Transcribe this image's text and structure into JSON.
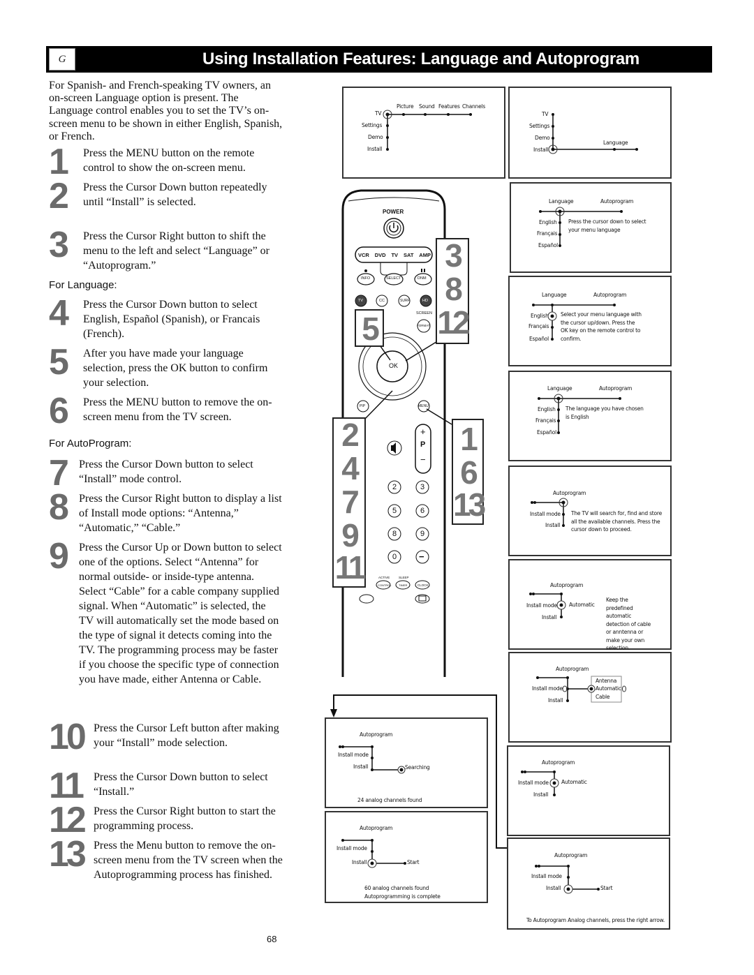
{
  "header": {
    "section_letter": "G",
    "title": "Using Installation Features: Language and Autoprogram"
  },
  "intro": "For Spanish- and French-speaking TV owners, an on-screen Language option is present. The Language control enables you to set the TV’s on-screen menu to be shown in either English, Spanish, or French.",
  "steps": [
    {
      "num": "1",
      "text": "Press the MENU button on the remote control to show the on-screen menu."
    },
    {
      "num": "2",
      "text": "Press the Cursor Down button repeatedly until “Install” is selected."
    },
    {
      "num": "3",
      "text": "Press the Cursor Right button to shift the menu to the left and select “Language” or “Autoprogram.”"
    },
    {
      "num": "4",
      "text": "Press the Cursor Down button to select English, Español (Spanish), or Francais (French)."
    },
    {
      "num": "5",
      "text": "After you have made your language selection, press the OK button to confirm your selection."
    },
    {
      "num": "6",
      "text": "Press the MENU button to remove the on-screen menu from the TV screen."
    },
    {
      "num": "7",
      "text": "Press the Cursor Down button to select “Install” mode control."
    },
    {
      "num": "8",
      "text": "Press the Cursor Right button to display a list of Install mode options: “Antenna,” “Automatic,” “Cable.”"
    },
    {
      "num": "9",
      "text": "Press the Cursor Up or Down button to select one of the options. Select “Antenna” for normal outside- or inside-type antenna. Select “Cable” for a cable company supplied signal. When “Automatic” is selected, the TV will automatically set the mode based on the type of signal it detects coming into the TV. The programming process may be faster if you choose the specific type of connection you have made, either Antenna or Cable."
    },
    {
      "num": "10",
      "text": "Press the Cursor Left button after making your “Install” mode selection."
    },
    {
      "num": "11",
      "text": "Press the Cursor Down button to select “Install.”"
    },
    {
      "num": "12",
      "text": "Press the Cursor Right button to start the programming process."
    },
    {
      "num": "13",
      "text": "Press the Menu button to remove the on-screen menu from the TV screen when the Autoprogramming process has finished."
    }
  ],
  "sections": {
    "language": "For Language:",
    "autoprogram": "For AutoProgram:"
  },
  "page_number": "68",
  "screens": {
    "s1": {
      "top": [
        "Picture",
        "Sound",
        "Features",
        "Channels"
      ],
      "left": [
        "TV",
        "Settings",
        "Demo",
        "Install"
      ]
    },
    "s2": {
      "left": [
        "TV",
        "Settings",
        "Demo",
        "Install"
      ],
      "right": "Language"
    },
    "s3": {
      "top": [
        "Language",
        "Autoprogram"
      ],
      "left": [
        "English",
        "Français",
        "Español"
      ],
      "note": "Press the cursor down to select your menu language"
    },
    "s4": {
      "top": [
        "Language",
        "Autoprogram"
      ],
      "left": [
        "English",
        "Français",
        "Español"
      ],
      "note": "Select your menu language with the cursor up/down. Press the OK key on the remote control to confirm."
    },
    "s5": {
      "top": [
        "Language",
        "Autoprogram"
      ],
      "left": [
        "English",
        "Français",
        "Español"
      ],
      "note": "The language you have chosen is English"
    },
    "s6": {
      "title": "Autoprogram",
      "left": [
        "Install mode",
        "Install"
      ],
      "note": "The TV will search for, find and store all the available channels. Press the cursor down to proceed."
    },
    "s7": {
      "title": "Autoprogram",
      "left": [
        "Install mode",
        "Install"
      ],
      "value": "Automatic",
      "note": "Keep the predefined automatic detection of cable or anntenna or make your own selection."
    },
    "s8": {
      "title": "Autoprogram",
      "left": [
        "Install mode",
        "Install"
      ],
      "options": [
        "Antenna",
        "Automatic",
        "Cable"
      ]
    },
    "s9": {
      "title": "Autoprogram",
      "left": [
        "Install mode",
        "Install"
      ],
      "value": "Automatic"
    },
    "s10": {
      "title": "Autoprogram",
      "left": [
        "Install mode",
        "Install"
      ],
      "value": "Start",
      "footer": "To Autoprogram Analog channels, press the right arrow."
    },
    "s11": {
      "title": "Autoprogram",
      "left": [
        "Install mode",
        "Install"
      ],
      "value": "Searching",
      "footer": "24 analog channels found"
    },
    "s12": {
      "title": "Autoprogram",
      "left": [
        "Install mode",
        "Install"
      ],
      "value": "Start",
      "footer": "60 analog channels found",
      "footer2": "Autoprogramming is complete"
    }
  },
  "remote": {
    "power": "POWER",
    "sources": [
      "VCR",
      "DVD",
      "TV",
      "SAT",
      "AMP"
    ],
    "row1": [
      "INFO",
      "SELECT",
      "DNM"
    ],
    "row2": [
      "TV",
      "CC",
      "SURF",
      "HD"
    ],
    "screen_label": "SCREEN",
    "format": "FORMAT",
    "ok": "OK",
    "pip": "PIP",
    "menu": "MENU",
    "prog": [
      "+",
      "P",
      "−"
    ],
    "digits": [
      "2",
      "3",
      "5",
      "6",
      "8",
      "9",
      "0",
      "−"
    ],
    "bottom_labels": [
      "ACTIVE",
      "SLEEP"
    ],
    "bottom_buttons": [
      "CONTROL",
      "TIMER",
      "CLOCK"
    ],
    "callouts": {
      "right_top": [
        "3",
        "8",
        "12"
      ],
      "left_mid": [
        "5"
      ],
      "left_bottom": [
        "2",
        "4",
        "7",
        "9",
        "11"
      ],
      "right_bottom": [
        "1",
        "6",
        "13"
      ]
    }
  }
}
